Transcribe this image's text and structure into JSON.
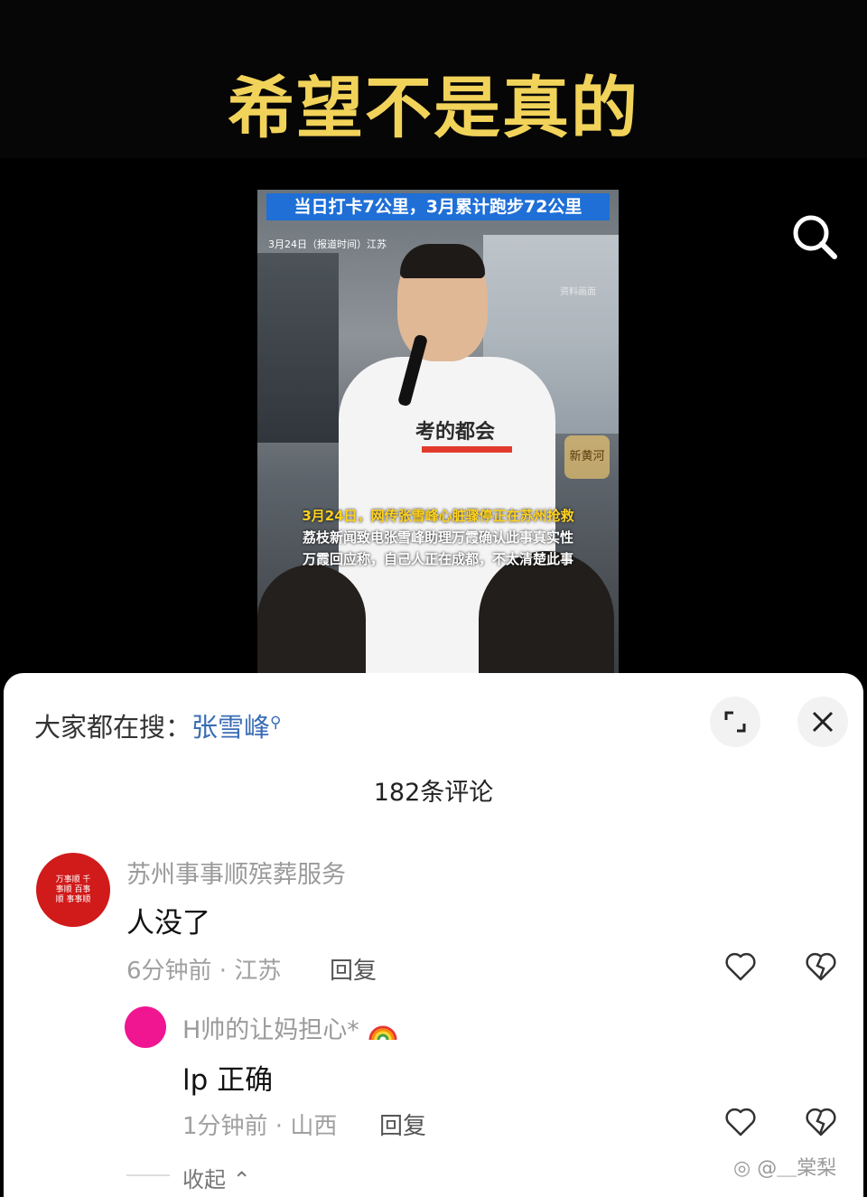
{
  "headline": "希望不是真的",
  "video": {
    "banner": "当日打卡7公里，3月累计跑步72公里",
    "date_line": "3月24日（报道时间）江苏",
    "source_tag": "资料画面",
    "shirt_text": "考的都会",
    "logo_text": "新黄河",
    "caption_line1": "3月24日，网传张雪峰心脏骤停正在苏州抢救",
    "caption_line2": "荔枝新闻致电张雪峰助理万霞确认此事真实性",
    "caption_line3": "万霞回应称，自己人正在成都，不太清楚此事"
  },
  "comments_panel": {
    "trending_prefix": "大家都在搜：",
    "trending_keyword": "张雪峰",
    "count_label": "182条评论",
    "comments": [
      {
        "avatar_text": "万事顺 千事顺 百事顺 事事顺",
        "username": "苏州事事顺殡葬服务",
        "text": "人没了",
        "meta": "6分钟前 · 江苏",
        "reply_label": "回复"
      }
    ],
    "replies": [
      {
        "username": "H帅的让妈担心*",
        "text": "lp 正确",
        "meta": "1分钟前 · 山西",
        "reply_label": "回复"
      }
    ],
    "collapse_label": "收起"
  },
  "watermark": "@＿棠梨",
  "colors": {
    "headline": "#f2d35a",
    "keyword": "#3a6db5",
    "banner": "#1f6fd6"
  }
}
